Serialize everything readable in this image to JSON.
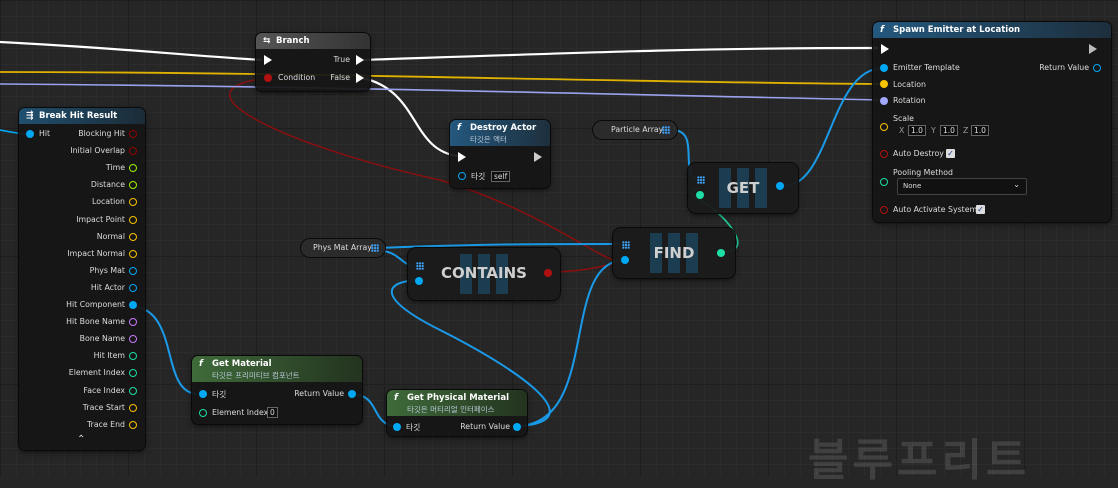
{
  "branch": {
    "title": "Branch",
    "condition": "Condition",
    "true_label": "True",
    "false_label": "False"
  },
  "break_hit": {
    "title": "Break Hit Result",
    "input": "Hit",
    "outputs": [
      "Blocking Hit",
      "Initial Overlap",
      "Time",
      "Distance",
      "Location",
      "Impact Point",
      "Normal",
      "Impact Normal",
      "Phys Mat",
      "Hit Actor",
      "Hit Component",
      "Hit Bone Name",
      "Bone Name",
      "Hit Item",
      "Element Index",
      "Face Index",
      "Trace Start",
      "Trace End"
    ],
    "expand_glyph": "⌃"
  },
  "destroy_actor": {
    "title": "Destroy Actor",
    "subtitle": "타깃은 액터",
    "target_label": "타깃",
    "target_value": "self"
  },
  "spawn_emitter": {
    "title": "Spawn Emitter at Location",
    "emitter_template": "Emitter Template",
    "return_value": "Return Value",
    "location": "Location",
    "rotation": "Rotation",
    "scale": "Scale",
    "scale_x_label": "X",
    "scale_x": "1.0",
    "scale_y_label": "Y",
    "scale_y": "1.0",
    "scale_z_label": "Z",
    "scale_z": "1.0",
    "auto_destroy": "Auto Destroy",
    "pooling_method": "Pooling Method",
    "pooling_value": "None",
    "auto_activate": "Auto Activate System",
    "check_glyph": "✓"
  },
  "particle_array": {
    "label": "Particle Array"
  },
  "phys_mat_array": {
    "label": "Phys Mat Array"
  },
  "macro_get": {
    "label": "GET"
  },
  "macro_find": {
    "label": "FIND"
  },
  "macro_contains": {
    "label": "CONTAINS"
  },
  "get_material": {
    "title": "Get Material",
    "subtitle": "타깃은 프리미티브 컴포넌트",
    "target_label": "타깃",
    "return_value": "Return Value",
    "element_index": "Element Index",
    "element_index_value": "0"
  },
  "get_phys_mat": {
    "title": "Get Physical Material",
    "subtitle": "타깃은 머티리얼 인터페이스",
    "target_label": "타깃",
    "return_value": "Return Value"
  },
  "function_glyph": "f",
  "branch_glyph": "⇆",
  "struct_glyph": "⇶",
  "watermark": "블루프리트",
  "colors": {
    "exec": "#ffffff",
    "object": "#00a8f4",
    "vector": "#f7c200",
    "rotator": "#a0a8ff",
    "bool": "#920101",
    "float": "#9ff200",
    "name": "#c87aff",
    "int": "#1edda6",
    "function_header": "#21547a",
    "pure_header": "#3f6b3a",
    "struct_header": "#1f4f6f"
  }
}
